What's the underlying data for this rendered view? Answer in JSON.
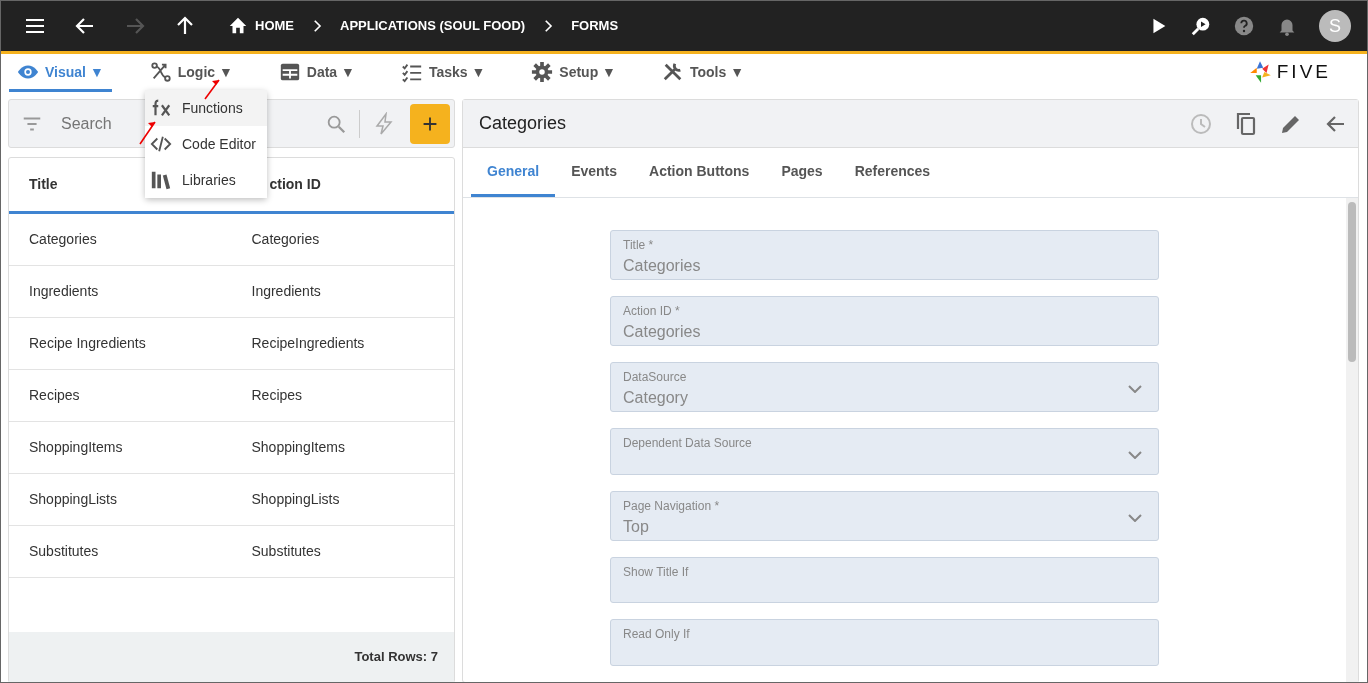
{
  "topbar": {
    "breadcrumbs": [
      {
        "label": "HOME",
        "kind": "home"
      },
      {
        "label": "APPLICATIONS (SOUL FOOD)",
        "kind": "plain"
      },
      {
        "label": "FORMS",
        "kind": "plain"
      }
    ],
    "avatar": "S"
  },
  "menubar": [
    {
      "label": "Visual",
      "caret": "▼",
      "selected": true
    },
    {
      "label": "Logic",
      "caret": "▼",
      "selected": false
    },
    {
      "label": "Data",
      "caret": "▼",
      "selected": false
    },
    {
      "label": "Tasks",
      "caret": "▼",
      "selected": false
    },
    {
      "label": "Setup",
      "caret": "▼",
      "selected": false
    },
    {
      "label": "Tools",
      "caret": "▼",
      "selected": false
    }
  ],
  "logo": "FIVE",
  "logic_menu": [
    {
      "label": "Functions",
      "selected": true
    },
    {
      "label": "Code Editor",
      "selected": false
    },
    {
      "label": "Libraries",
      "selected": false
    }
  ],
  "search": {
    "placeholder": "Search"
  },
  "table": {
    "columns": [
      "Title",
      "ction ID"
    ],
    "rows": [
      [
        "Categories",
        "Categories"
      ],
      [
        "Ingredients",
        "Ingredients"
      ],
      [
        "Recipe Ingredients",
        "RecipeIngredients"
      ],
      [
        "Recipes",
        "Recipes"
      ],
      [
        "ShoppingItems",
        "ShoppingItems"
      ],
      [
        "ShoppingLists",
        "ShoppingLists"
      ],
      [
        "Substitutes",
        "Substitutes"
      ]
    ],
    "footer": "Total Rows: 7"
  },
  "detail": {
    "title": "Categories",
    "tabs": [
      {
        "label": "General",
        "selected": true
      },
      {
        "label": "Events",
        "selected": false
      },
      {
        "label": "Action Buttons",
        "selected": false
      },
      {
        "label": "Pages",
        "selected": false
      },
      {
        "label": "References",
        "selected": false
      }
    ],
    "fields": [
      {
        "label": "Title *",
        "value": "Categories",
        "kind": "text"
      },
      {
        "label": "Action ID *",
        "value": "Categories",
        "kind": "text"
      },
      {
        "label": "DataSource",
        "value": "Category",
        "kind": "select"
      },
      {
        "label": "Dependent Data Source",
        "kind": "select"
      },
      {
        "label": "Page Navigation *",
        "value": "Top",
        "kind": "select"
      },
      {
        "label": "Show Title If",
        "kind": "text"
      },
      {
        "label": "Read Only If",
        "kind": "text"
      }
    ]
  }
}
